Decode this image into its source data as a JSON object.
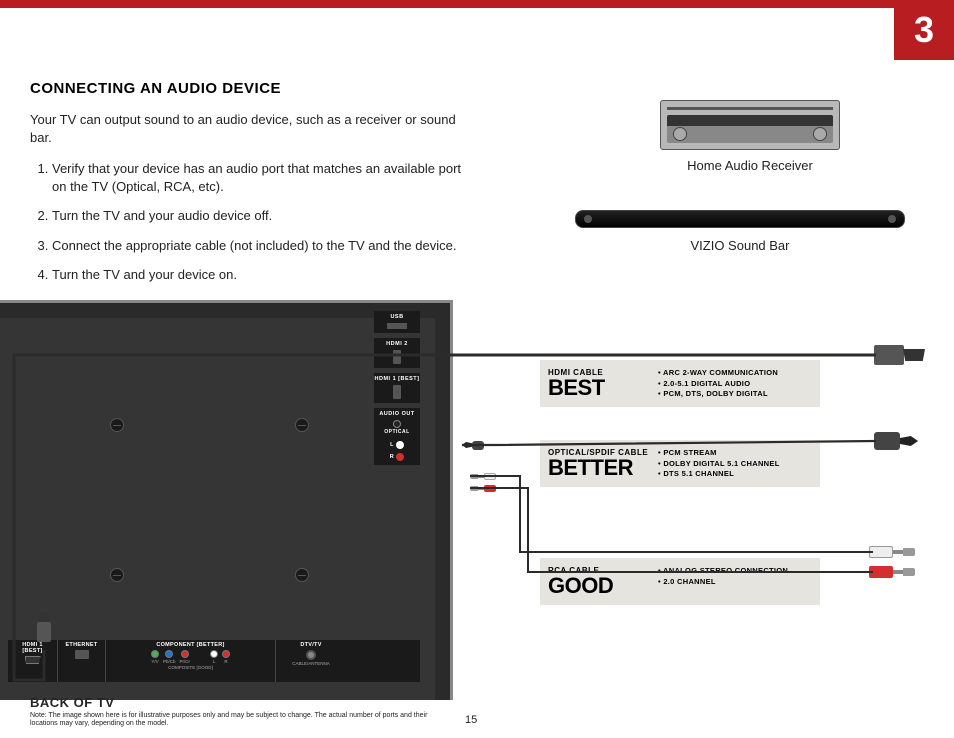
{
  "page": {
    "number": "3",
    "footer_page": "15"
  },
  "section": {
    "title": "CONNECTING AN AUDIO DEVICE",
    "intro": "Your TV can output sound to an audio device, such as a receiver or sound bar.",
    "steps": [
      "Verify that your device has an audio port that matches an available port on the TV (Optical, RCA, etc).",
      "Turn the TV and your audio device off.",
      "Connect the appropriate cable (not included) to the TV and the device.",
      "Turn the TV and your device on."
    ]
  },
  "devices": {
    "receiver_label": "Home Audio Receiver",
    "soundbar_label": "VIZIO Sound Bar"
  },
  "cables": {
    "best": {
      "name": "HDMI CABLE",
      "rating": "BEST",
      "features": [
        "ARC 2-WAY COMMUNICATION",
        "2.0-5.1 DIGITAL AUDIO",
        "PCM, DTS, DOLBY DIGITAL"
      ]
    },
    "better": {
      "name": "OPTICAL/SPDIF CABLE",
      "rating": "BETTER",
      "features": [
        "PCM STREAM",
        "DOLBY DIGITAL 5.1 CHANNEL",
        "DTS 5.1 CHANNEL"
      ]
    },
    "good": {
      "name": "RCA CABLE",
      "rating": "GOOD",
      "features": [
        "ANALOG STEREO CONNECTION",
        "2.0 CHANNEL"
      ]
    }
  },
  "tv_ports": {
    "vertical": {
      "usb": "USB",
      "hdmi2": "HDMI 2",
      "hdmi1": "HDMI 1 [BEST]",
      "audio_out": "AUDIO OUT",
      "optical": "OPTICAL",
      "left": "L",
      "right": "R"
    },
    "bottom": {
      "hdmi_best": "HDMI 1 [BEST]",
      "ethernet": "ETHERNET",
      "component": "COMPONENT [BETTER]",
      "comp_yv": "Y/V",
      "comp_pb": "Pb/Cb",
      "comp_pr": "Pr/Cr",
      "comp_l": "L",
      "comp_r": "R",
      "composite_sub": "COMPOSITE [GOOD]",
      "dtv": "DTV/TV",
      "cable_antenna": "CABLE/ANTENNA"
    }
  },
  "labels": {
    "back_of_tv": "BACK OF TV",
    "note": "Note:  The image shown here is for illustrative purposes only and may be subject to change. The actual number of ports and their locations may vary, depending on the model."
  }
}
